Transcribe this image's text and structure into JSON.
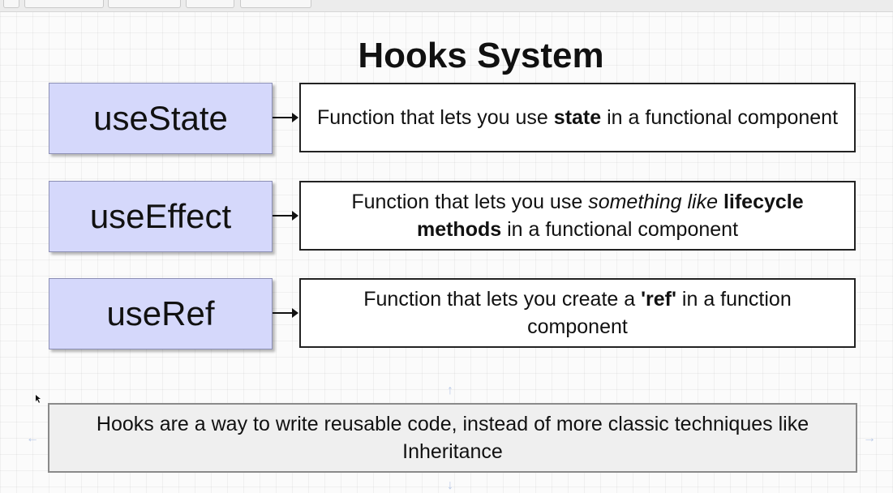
{
  "title": "Hooks System",
  "hooks": [
    {
      "name": "useState",
      "desc_parts": [
        {
          "t": "Function that lets you use ",
          "s": "normal"
        },
        {
          "t": "state",
          "s": "bold"
        },
        {
          "t": " in a functional component",
          "s": "normal"
        }
      ]
    },
    {
      "name": "useEffect",
      "desc_parts": [
        {
          "t": "Function that lets you use ",
          "s": "normal"
        },
        {
          "t": "something like",
          "s": "italic"
        },
        {
          "t": " ",
          "s": "normal"
        },
        {
          "t": "lifecycle methods",
          "s": "bold"
        },
        {
          "t": " in a functional component",
          "s": "normal"
        }
      ]
    },
    {
      "name": "useRef",
      "desc_parts": [
        {
          "t": "Function that lets you create a ",
          "s": "normal"
        },
        {
          "t": "'ref'",
          "s": "bold"
        },
        {
          "t": " in a function component",
          "s": "normal"
        }
      ]
    }
  ],
  "summary": "Hooks are a way to write reusable code, instead of more classic techniques like Inheritance",
  "colors": {
    "hook_fill": "#d5d8fb",
    "hook_border": "#8c8fb5",
    "summary_fill": "#efefef",
    "handle": "#b9c9e6"
  },
  "icons": {
    "connector": "arrow-right-icon",
    "handles": [
      "arrow-up-icon",
      "arrow-down-icon",
      "arrow-left-icon",
      "arrow-right-icon"
    ],
    "pointer": "mouse-cursor-icon"
  }
}
